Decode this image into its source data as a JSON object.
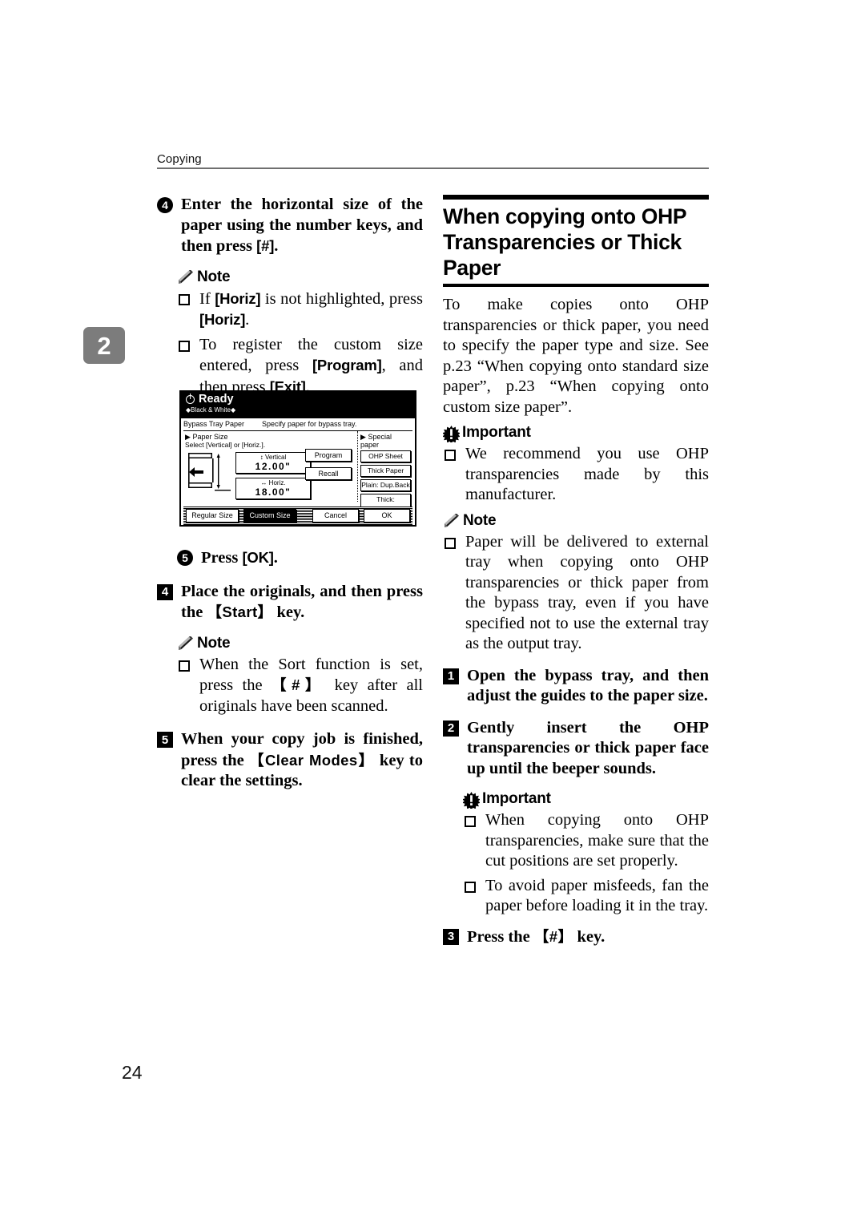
{
  "header": {
    "running_head": "Copying",
    "chapter_tab": "2",
    "page_number": "24"
  },
  "left_column": {
    "step4": {
      "number": "4",
      "text_1": "Enter the horizontal size of the",
      "text_2": "paper using the number keys,",
      "text_3": "and then press ",
      "key": "[#]",
      "text_4": "."
    },
    "note_1": {
      "heading": "Note",
      "items": [
        {
          "pre": "If ",
          "key1": "[Horiz]",
          "mid": " is not highlighted, press ",
          "key2": "[Horiz]",
          "post": "."
        },
        {
          "pre": "To register the custom size entered, press ",
          "key1": "[Program]",
          "mid": ", and then press ",
          "key2": "[Exit]",
          "post": "."
        }
      ]
    },
    "step5_sub": {
      "number": "5",
      "pre": "Press ",
      "key": "[OK]",
      "post": "."
    },
    "step4_main": {
      "number": "4",
      "pre": "Place the originals, and then press the ",
      "key": "【Start】",
      "post": " key."
    },
    "note_2": {
      "heading": "Note",
      "items": [
        {
          "pre": "When the Sort function is set, press the ",
          "key1": "【#】",
          "post": " key after all originals have been scanned."
        }
      ]
    },
    "step5_main": {
      "number": "5",
      "pre": "When your copy job is finished, press the ",
      "key": "【Clear Modes】",
      "post": " key to clear the settings."
    }
  },
  "lcd": {
    "status": "Ready",
    "color_mode": "◆Black & White◆",
    "screen_title": "Bypass Tray Paper",
    "screen_instruction": "Specify paper for bypass tray.",
    "paper_size_heading": "Paper Size",
    "paper_size_sub": "Select [Vertical] or [Horiz.].",
    "vertical": {
      "label": "Vertical",
      "value": "12.00\""
    },
    "horiz": {
      "label": "Horiz.",
      "value": "18.00\""
    },
    "program_button": "Program",
    "recall_button": "Recall",
    "special_paper_heading": "Special paper",
    "special_paper_buttons": [
      "OHP Sheet",
      "Thick Paper",
      "Plain: Dup.Back",
      "Thick: Dup.Back"
    ],
    "bottom_buttons": [
      {
        "label": "Regular Size",
        "selected": false
      },
      {
        "label": "Custom Size",
        "selected": true
      }
    ],
    "cancel_button": "Cancel",
    "ok_button": "OK"
  },
  "right_column": {
    "section_title_line1": "When copying onto OHP",
    "section_title_line2": "Transparencies or Thick Paper",
    "intro": "To make copies onto OHP transparencies or thick paper, you need to specify the paper type and size. See p.23 “When copying onto standard size paper”, p.23 “When copying onto custom size paper”.",
    "important_1": {
      "heading": "Important",
      "items": [
        "We recommend you use OHP transparencies made by this manufacturer."
      ]
    },
    "note_1": {
      "heading": "Note",
      "items": [
        "Paper will be delivered to external tray when copying onto OHP transparencies or thick paper from the bypass tray, even if you have specified not to use the external tray as the output tray."
      ]
    },
    "step1": {
      "number": "1",
      "text": "Open the bypass tray, and then adjust the guides to the paper size."
    },
    "step2": {
      "number": "2",
      "text": "Gently insert the OHP transparencies or thick paper face up until the beeper sounds."
    },
    "important_2": {
      "heading": "Important",
      "items": [
        "When copying onto OHP transparencies, make sure that the cut positions are set properly.",
        "To avoid paper misfeeds, fan the paper before loading it in the tray."
      ]
    },
    "step3": {
      "number": "3",
      "pre": "Press the ",
      "key": "【#】",
      "post": " key."
    }
  },
  "colors": {
    "chapter_tab_bg": "#7c7c7c",
    "rule": "#6f6f6f",
    "text": "#000000"
  }
}
